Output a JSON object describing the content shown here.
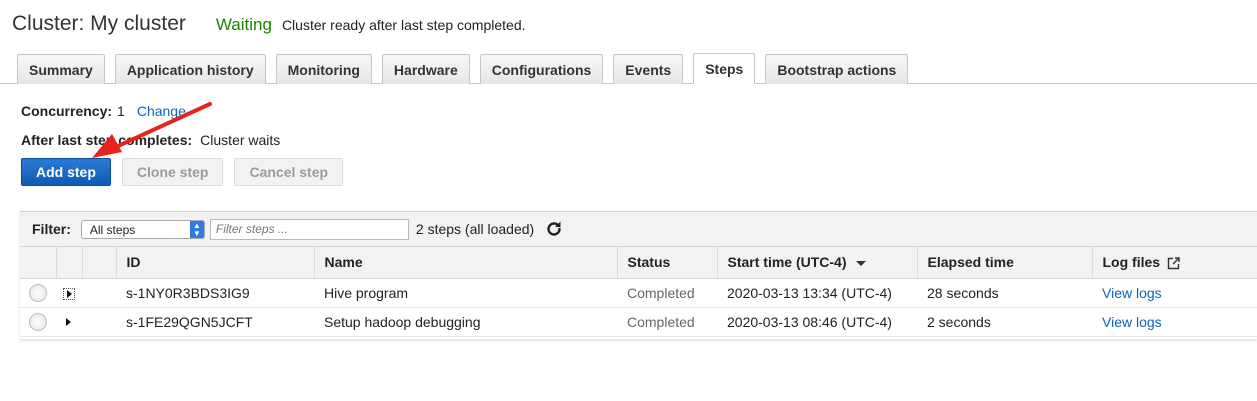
{
  "header": {
    "title": "Cluster: My cluster",
    "state": "Waiting",
    "state_message": "Cluster ready after last step completed."
  },
  "tabs": [
    {
      "label": "Summary",
      "active": false
    },
    {
      "label": "Application history",
      "active": false
    },
    {
      "label": "Monitoring",
      "active": false
    },
    {
      "label": "Hardware",
      "active": false
    },
    {
      "label": "Configurations",
      "active": false
    },
    {
      "label": "Events",
      "active": false
    },
    {
      "label": "Steps",
      "active": true
    },
    {
      "label": "Bootstrap actions",
      "active": false
    }
  ],
  "concurrency": {
    "label": "Concurrency:",
    "value": "1",
    "change_link": "Change"
  },
  "after_last_step": {
    "label": "After last step completes:",
    "value": "Cluster waits"
  },
  "actions": {
    "add_step": "Add step",
    "clone_step": "Clone step",
    "cancel_step": "Cancel step"
  },
  "filter": {
    "label": "Filter:",
    "selected": "All steps",
    "search_placeholder": "Filter steps ...",
    "count_text": "2 steps (all loaded)"
  },
  "table": {
    "columns": [
      "ID",
      "Name",
      "Status",
      "Start time (UTC-4)",
      "Elapsed time",
      "Log files"
    ],
    "rows": [
      {
        "id": "s-1NY0R3BDS3IG9",
        "name": "Hive program",
        "status": "Completed",
        "start_time": "2020-03-13 13:34 (UTC-4)",
        "elapsed": "28 seconds",
        "logs": "View logs"
      },
      {
        "id": "s-1FE29QGN5JCFT",
        "name": "Setup hadoop debugging",
        "status": "Completed",
        "start_time": "2020-03-13 08:46 (UTC-4)",
        "elapsed": "2 seconds",
        "logs": "View logs"
      }
    ]
  },
  "colors": {
    "accent_link": "#0b66b8",
    "primary_button": "#0d5bb5",
    "status_waiting": "#1d8102",
    "annotation_arrow": "#e8231b"
  }
}
